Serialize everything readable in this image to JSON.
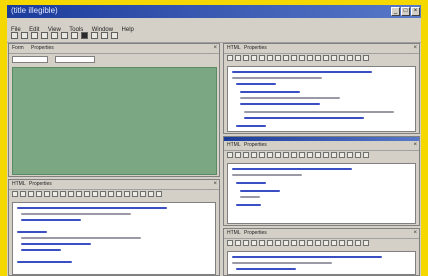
{
  "window": {
    "title": "(title illegible)"
  },
  "menu": [
    "File",
    "Edit",
    "View",
    "Tools",
    "Window",
    "Help"
  ],
  "left_top_panel": {
    "tabs": [
      "Form",
      "Properties"
    ],
    "selects": [
      "",
      ""
    ],
    "area_label": ""
  },
  "right_top_panel": {
    "tabs": [
      "HTML",
      "Properties"
    ]
  },
  "right_mid_panel": {
    "tabs": [
      "HTML",
      "Properties"
    ]
  },
  "right_bottom_panel": {
    "tabs": [
      "HTML",
      "Properties"
    ]
  },
  "left_bottom_panel": {
    "tabs": [
      "HTML",
      "Properties"
    ]
  },
  "colors": {
    "frame": "#f5d800",
    "titlebar_start": "#1c3c9c",
    "titlebar_end": "#5878c8",
    "chrome": "#d4d0c8",
    "form_area": "#7ba883",
    "code_blue": "#3a4fc4",
    "code_gray": "#9a9aa6"
  },
  "icons": [
    "minimize-icon",
    "maximize-icon",
    "close-icon",
    "toolbar-icon"
  ]
}
